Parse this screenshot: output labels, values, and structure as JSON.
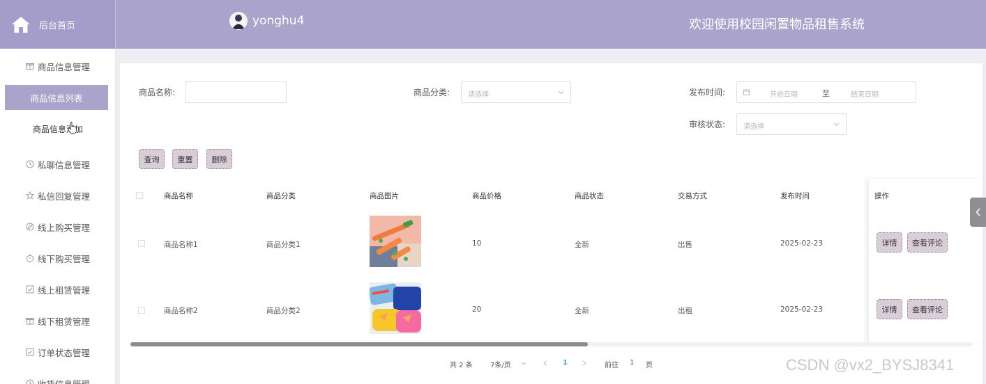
{
  "header": {
    "brand_label": "后台首页",
    "username": "yonghu4",
    "system_title": "欢迎使用校园闲置物品租售系统"
  },
  "sidebar": {
    "items": [
      {
        "label": "商品信息管理",
        "icon": "gift-icon"
      },
      {
        "label": "私聊信息管理",
        "icon": "clock-icon"
      },
      {
        "label": "私信回复管理",
        "icon": "star-icon"
      },
      {
        "label": "线上购买管理",
        "icon": "compass-icon"
      },
      {
        "label": "线下购买管理",
        "icon": "timer-icon"
      },
      {
        "label": "线上租赁管理",
        "icon": "check-square-icon"
      },
      {
        "label": "线下租赁管理",
        "icon": "gift-icon"
      },
      {
        "label": "订单状态管理",
        "icon": "check-square-icon"
      },
      {
        "label": "收货信息管理",
        "icon": "clock-icon"
      }
    ],
    "sub_active": "商品信息列表",
    "sub_item": "商品信息添加"
  },
  "search": {
    "name_label": "商品名称:",
    "name_value": "",
    "category_label": "商品分类:",
    "category_placeholder": "请选择",
    "time_label": "发布时间:",
    "start_placeholder": "开始日期",
    "range_sep": "至",
    "end_placeholder": "结束日期",
    "audit_label": "审核状态:",
    "audit_placeholder": "请选择"
  },
  "actions": {
    "query": "查询",
    "reset": "重置",
    "delete": "删除"
  },
  "table": {
    "columns": [
      "商品名称",
      "商品分类",
      "商品图片",
      "商品价格",
      "商品状态",
      "交易方式",
      "发布时间",
      "操作"
    ],
    "rows": [
      {
        "name": "商品名称1",
        "category": "商品分类1",
        "price": "10",
        "status": "全新",
        "trade": "出售",
        "date": "2025-02-23",
        "detail": "详情",
        "comment": "查看评论"
      },
      {
        "name": "商品名称2",
        "category": "商品分类2",
        "price": "20",
        "status": "全新",
        "trade": "出租",
        "date": "2025-02-23",
        "detail": "详情",
        "comment": "查看评论"
      }
    ]
  },
  "pagination": {
    "total": "共 2 条",
    "page_size": "7条/页",
    "current": "1",
    "goto_prefix": "前往",
    "goto_value": "1",
    "goto_suffix": "页"
  },
  "watermark": "CSDN @vx2_BYSJ8341",
  "colors": {
    "header": "#aaa3cc",
    "button": "#d9cdd8",
    "pager_active": "#409eff"
  }
}
